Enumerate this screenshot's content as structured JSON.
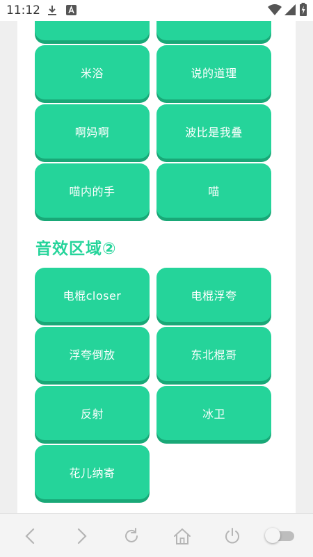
{
  "status_bar": {
    "time": "11:12",
    "icons": [
      "download-icon",
      "a-icon",
      "wifi-icon",
      "signal-icon",
      "battery-icon"
    ]
  },
  "sections": {
    "partial_top": [
      {
        "label": ""
      },
      {
        "label": ""
      }
    ],
    "section1_buttons": [
      {
        "label": "米浴"
      },
      {
        "label": "说的道理"
      },
      {
        "label": "啊妈啊"
      },
      {
        "label": "波比是我叠"
      },
      {
        "label": "喵内的手"
      },
      {
        "label": "喵"
      }
    ],
    "section2_title": "音效区域②",
    "section2_buttons": [
      {
        "label": "电棍closer"
      },
      {
        "label": "电棍浮夸"
      },
      {
        "label": "浮夸倒放"
      },
      {
        "label": "东北棍哥"
      },
      {
        "label": "反射"
      },
      {
        "label": "冰卫"
      },
      {
        "label": "花儿纳寄"
      }
    ]
  },
  "colors": {
    "button": "#25d49a",
    "button_shadow": "#19a877",
    "title": "#25d49a"
  },
  "nav_bar": {
    "icons": [
      "back-icon",
      "forward-icon",
      "reload-icon",
      "home-icon",
      "power-icon",
      "toggle-switch"
    ],
    "toggle_on": false
  }
}
